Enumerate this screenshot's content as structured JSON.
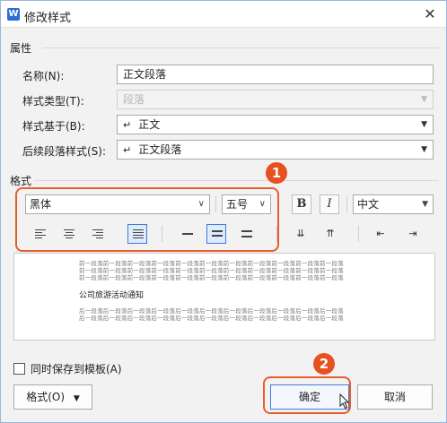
{
  "dialog": {
    "title": "修改样式",
    "app_icon": "W",
    "close_glyph": "✕"
  },
  "properties": {
    "section_label": "属性",
    "name_label": "名称(N):",
    "name_value": "正文段落",
    "type_label": "样式类型(T):",
    "type_value": "段落",
    "based_on_label": "样式基于(B):",
    "based_on_value": "正文",
    "next_label": "后续段落样式(S):",
    "next_value": "正文段落",
    "enter_glyph": "↵"
  },
  "format": {
    "section_label": "格式",
    "font_value": "黑体",
    "size_value": "五号",
    "bold_label": "B",
    "italic_label": "I",
    "lang_value": "中文",
    "active_align": "justify",
    "active_spacing": "1.5"
  },
  "preview": {
    "prev_lines": [
      "前一段落前一段落前一段落前一段落前一段落前一段落前一段落前一段落前一段落前一段落前一段落",
      "前一段落前一段落前一段落前一段落前一段落前一段落前一段落前一段落前一段落前一段落前一段落",
      "前一段落前一段落前一段落前一段落前一段落前一段落前一段落前一段落前一段落前一段落前一段落"
    ],
    "main_text": "公司旅游活动通知",
    "next_lines": [
      "后一段落后一段落后一段落后一段落后一段落后一段落后一段落后一段落后一段落后一段落后一段落",
      "后一段落后一段落后一段落后一段落后一段落后一段落后一段落后一段落后一段落后一段落后一段落"
    ]
  },
  "footer": {
    "template_checkbox_label": "同时保存到模板(A)",
    "template_checked": false,
    "format_button": "格式(O)",
    "ok_button": "确定",
    "cancel_button": "取消"
  },
  "annotations": {
    "badge1": "1",
    "badge2": "2",
    "color": "#e8501f"
  },
  "colors": {
    "accent": "#3f7bd9",
    "annotation": "#e85c2e"
  }
}
